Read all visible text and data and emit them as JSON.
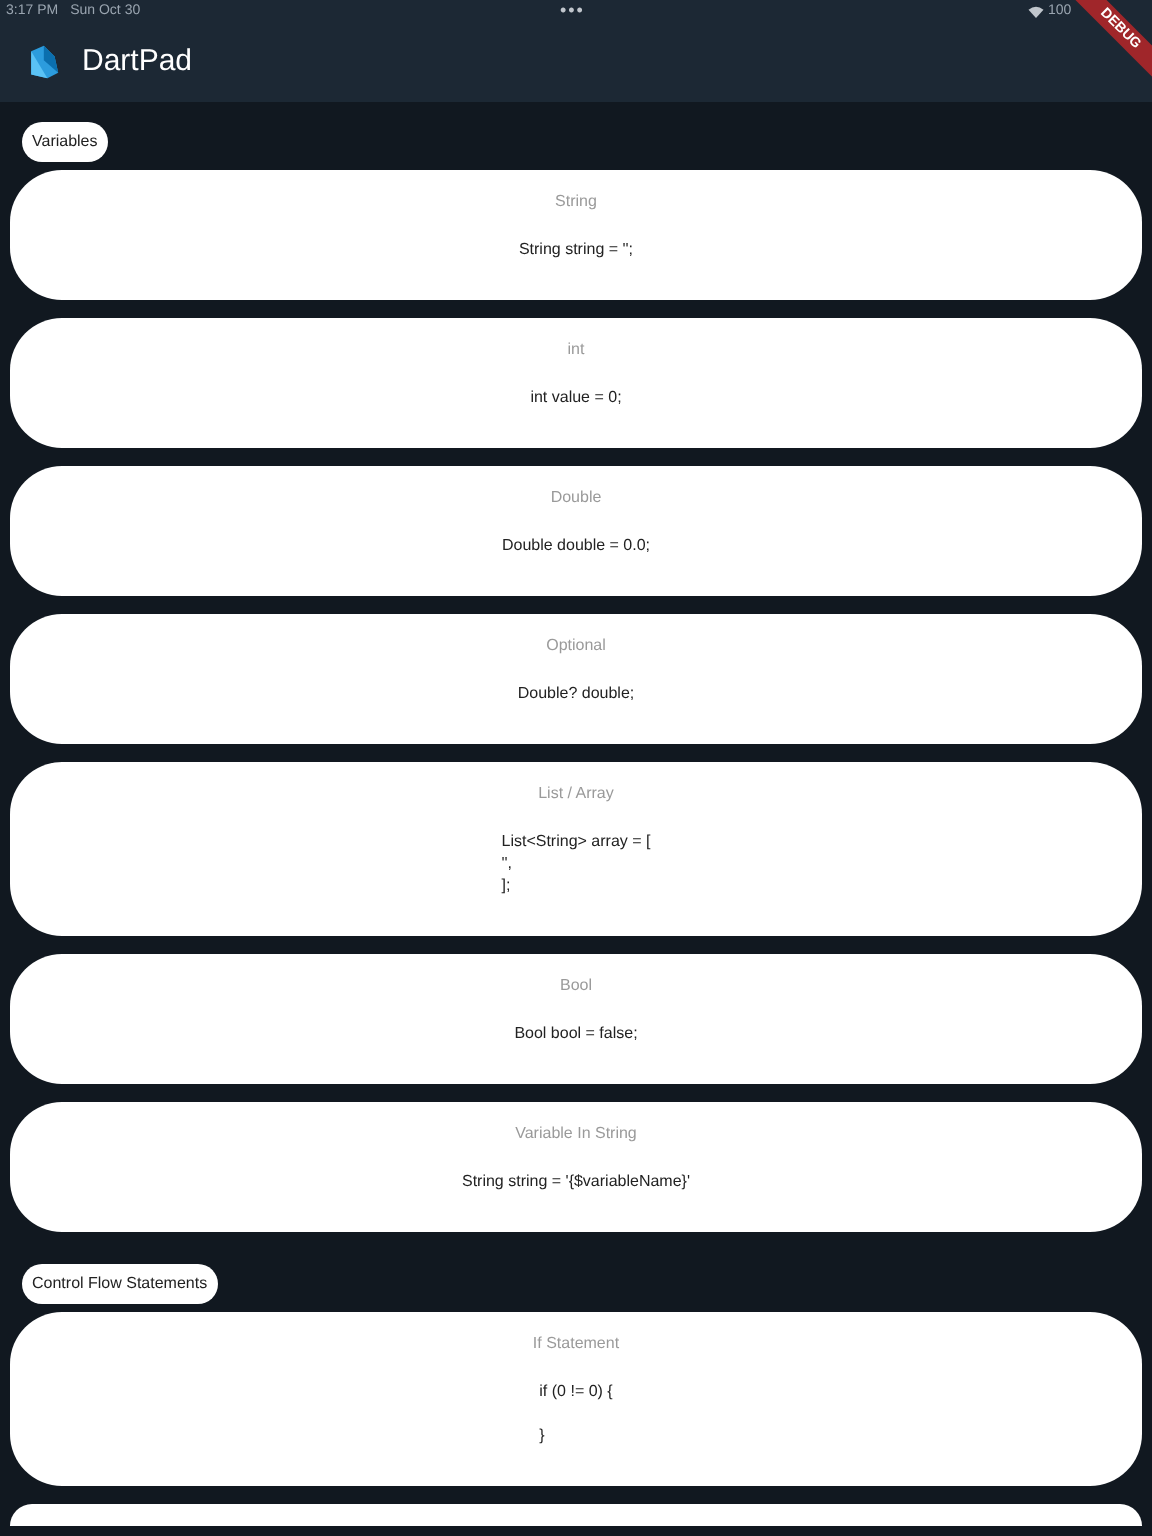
{
  "status_bar": {
    "time": "3:17 PM",
    "date": "Sun Oct 30",
    "dots": "•••",
    "battery": "100"
  },
  "debug_banner": "DEBUG",
  "app_bar": {
    "title": "DartPad"
  },
  "sections": [
    {
      "label": "Variables",
      "cards": [
        {
          "kind": "snippet",
          "title": "String",
          "code": "String string = '';"
        },
        {
          "kind": "snippet",
          "title": "int",
          "code": "int value = 0;"
        },
        {
          "kind": "snippet",
          "title": "Double",
          "code": "Double double = 0.0;"
        },
        {
          "kind": "snippet",
          "title": "Optional",
          "code": "Double? double;"
        },
        {
          "kind": "snippet",
          "title": "List / Array",
          "code": "List<String> array = [\n'',\n];"
        },
        {
          "kind": "snippet",
          "title": "Bool",
          "code": "Bool bool = false;"
        },
        {
          "kind": "snippet",
          "title": "Variable In String",
          "code": "String string = '{$variableName}'"
        }
      ]
    },
    {
      "label": "Control Flow Statements",
      "cards": [
        {
          "kind": "snippet",
          "title": "If Statement",
          "code": "if (0 != 0) {\n\n}"
        },
        {
          "kind": "blank"
        }
      ]
    }
  ]
}
